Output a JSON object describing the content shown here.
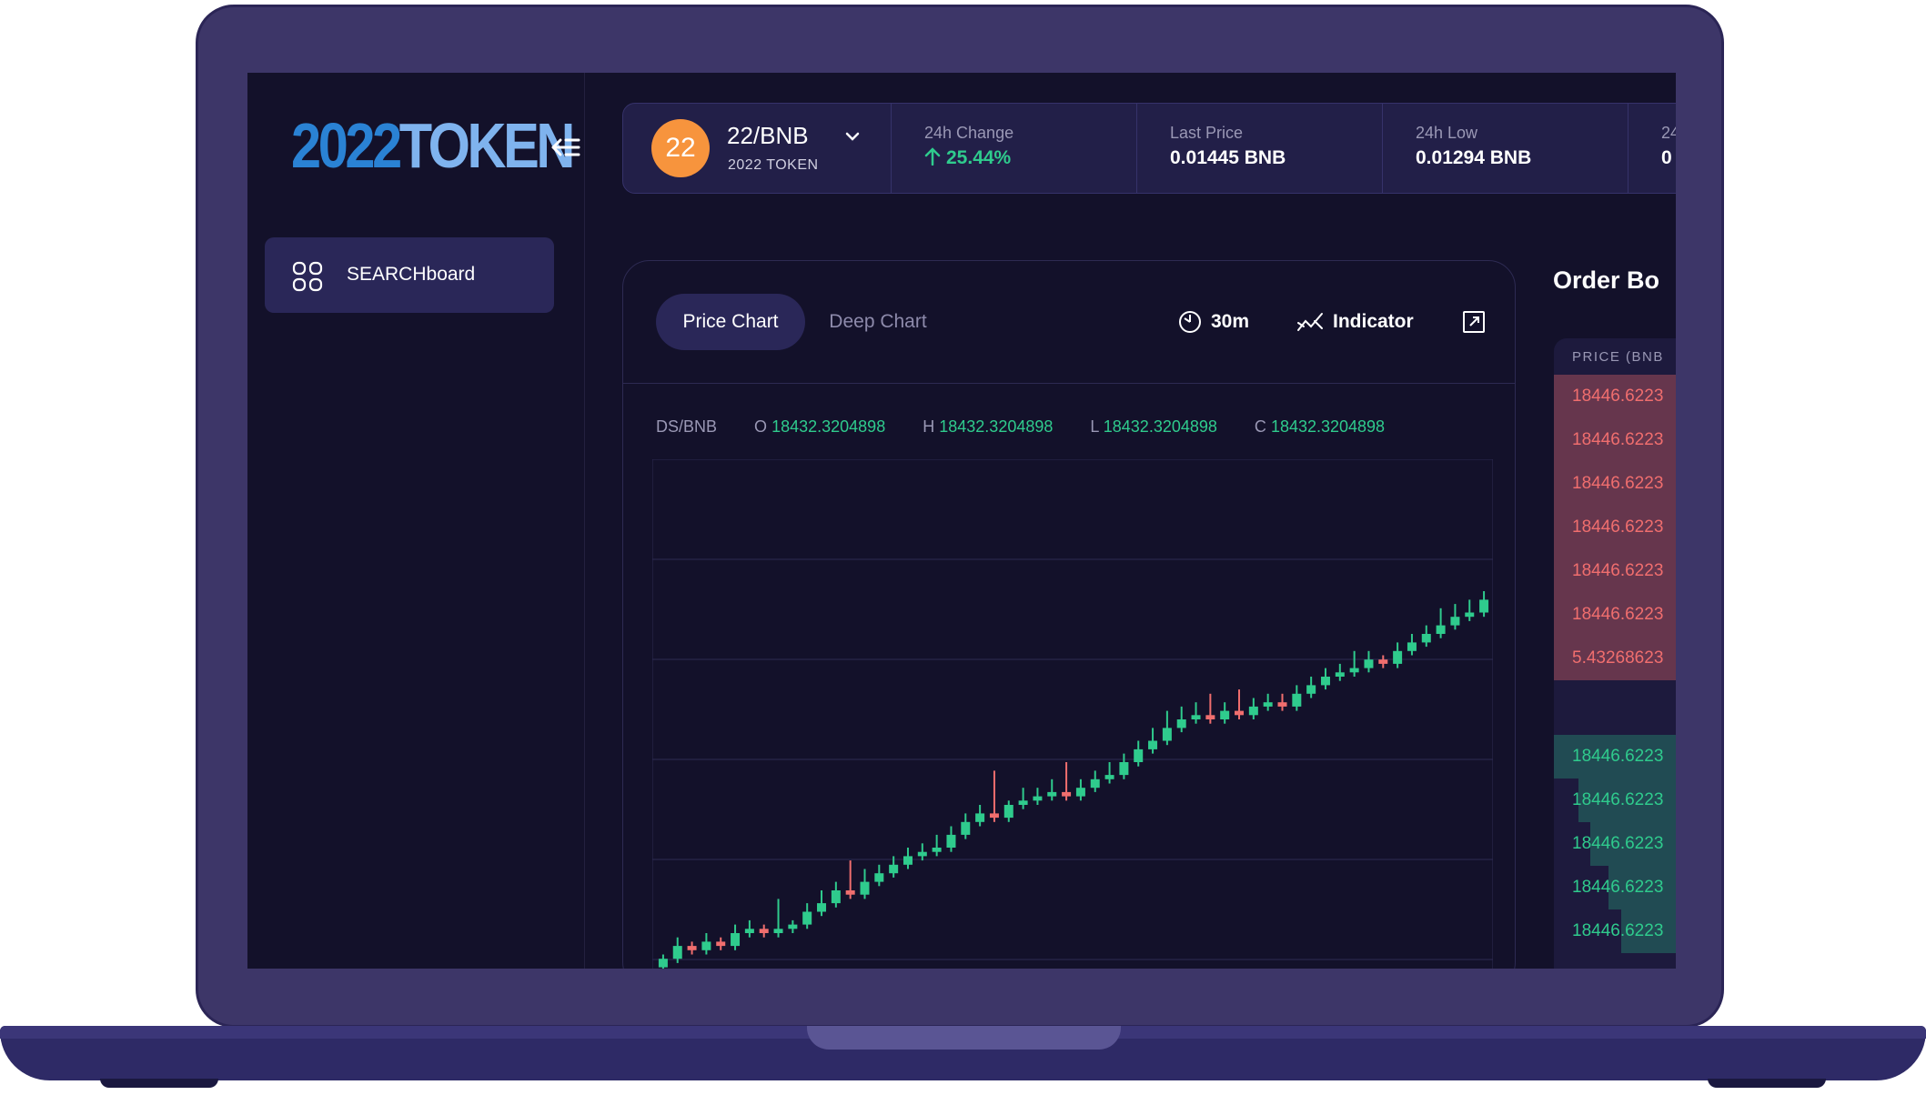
{
  "sidebar": {
    "logo_part1": "2022",
    "logo_part2": "TOKEN",
    "nav_item": "SEARCHboard"
  },
  "header": {
    "coin_badge": "22",
    "pair": "22/BNB",
    "token_name": "2022 TOKEN",
    "stats": [
      {
        "label": "24h Change",
        "value": "25.44%",
        "direction": "up"
      },
      {
        "label": "Last Price",
        "value": "0.01445 BNB"
      },
      {
        "label": "24h Low",
        "value": "0.01294 BNB"
      },
      {
        "label": "24",
        "value": "0"
      }
    ]
  },
  "chart_panel": {
    "tabs": [
      "Price Chart",
      "Deep Chart"
    ],
    "active_tab": "Price Chart",
    "interval": "30m",
    "indicator_label": "Indicator",
    "symbol": "DS/BNB",
    "ohlc": {
      "o_label": "O",
      "o": "18432.3204898",
      "h_label": "H",
      "h": "18432.3204898",
      "l_label": "L",
      "l": "18432.3204898",
      "c_label": "C",
      "c": "18432.3204898"
    }
  },
  "chart_data": {
    "type": "candlestick",
    "up_color": "#2fcb8d",
    "down_color": "#f06e6e",
    "grid": true,
    "candles": [
      [
        0.02,
        0.04,
        0.0,
        0.05
      ],
      [
        0.04,
        0.07,
        0.03,
        0.09
      ],
      [
        0.07,
        0.06,
        0.05,
        0.08
      ],
      [
        0.06,
        0.08,
        0.05,
        0.1
      ],
      [
        0.08,
        0.07,
        0.06,
        0.09
      ],
      [
        0.07,
        0.1,
        0.06,
        0.12
      ],
      [
        0.1,
        0.11,
        0.09,
        0.13
      ],
      [
        0.11,
        0.1,
        0.09,
        0.12
      ],
      [
        0.1,
        0.11,
        0.09,
        0.18
      ],
      [
        0.11,
        0.12,
        0.1,
        0.13
      ],
      [
        0.12,
        0.15,
        0.11,
        0.17
      ],
      [
        0.15,
        0.17,
        0.14,
        0.2
      ],
      [
        0.17,
        0.2,
        0.16,
        0.22
      ],
      [
        0.2,
        0.19,
        0.18,
        0.27
      ],
      [
        0.19,
        0.22,
        0.18,
        0.25
      ],
      [
        0.22,
        0.24,
        0.21,
        0.26
      ],
      [
        0.24,
        0.26,
        0.23,
        0.28
      ],
      [
        0.26,
        0.28,
        0.25,
        0.3
      ],
      [
        0.28,
        0.29,
        0.27,
        0.31
      ],
      [
        0.29,
        0.3,
        0.28,
        0.33
      ],
      [
        0.3,
        0.33,
        0.29,
        0.35
      ],
      [
        0.33,
        0.36,
        0.32,
        0.38
      ],
      [
        0.36,
        0.38,
        0.35,
        0.4
      ],
      [
        0.38,
        0.37,
        0.36,
        0.48
      ],
      [
        0.37,
        0.4,
        0.36,
        0.41
      ],
      [
        0.4,
        0.41,
        0.39,
        0.44
      ],
      [
        0.41,
        0.42,
        0.4,
        0.44
      ],
      [
        0.42,
        0.43,
        0.41,
        0.46
      ],
      [
        0.43,
        0.42,
        0.41,
        0.5
      ],
      [
        0.42,
        0.44,
        0.41,
        0.46
      ],
      [
        0.44,
        0.46,
        0.43,
        0.48
      ],
      [
        0.46,
        0.47,
        0.45,
        0.5
      ],
      [
        0.47,
        0.5,
        0.46,
        0.52
      ],
      [
        0.5,
        0.53,
        0.49,
        0.55
      ],
      [
        0.53,
        0.55,
        0.52,
        0.58
      ],
      [
        0.55,
        0.58,
        0.54,
        0.62
      ],
      [
        0.58,
        0.6,
        0.57,
        0.63
      ],
      [
        0.6,
        0.61,
        0.59,
        0.64
      ],
      [
        0.61,
        0.6,
        0.59,
        0.66
      ],
      [
        0.6,
        0.62,
        0.59,
        0.64
      ],
      [
        0.62,
        0.61,
        0.6,
        0.67
      ],
      [
        0.61,
        0.63,
        0.6,
        0.65
      ],
      [
        0.63,
        0.64,
        0.62,
        0.66
      ],
      [
        0.64,
        0.63,
        0.62,
        0.66
      ],
      [
        0.63,
        0.66,
        0.62,
        0.68
      ],
      [
        0.66,
        0.68,
        0.65,
        0.7
      ],
      [
        0.68,
        0.7,
        0.67,
        0.72
      ],
      [
        0.7,
        0.71,
        0.69,
        0.73
      ],
      [
        0.71,
        0.72,
        0.7,
        0.76
      ],
      [
        0.72,
        0.74,
        0.71,
        0.76
      ],
      [
        0.74,
        0.73,
        0.72,
        0.75
      ],
      [
        0.73,
        0.76,
        0.72,
        0.78
      ],
      [
        0.76,
        0.78,
        0.75,
        0.8
      ],
      [
        0.78,
        0.8,
        0.77,
        0.82
      ],
      [
        0.8,
        0.82,
        0.79,
        0.86
      ],
      [
        0.82,
        0.84,
        0.81,
        0.87
      ],
      [
        0.84,
        0.85,
        0.83,
        0.88
      ],
      [
        0.85,
        0.88,
        0.84,
        0.9
      ]
    ]
  },
  "order_book": {
    "title": "Order Bo",
    "column_header": "PRICE (BNB",
    "asks": [
      "18446.6223",
      "18446.6223",
      "18446.6223",
      "18446.6223",
      "18446.6223",
      "18446.6223",
      "5.43268623"
    ],
    "bids": [
      "18446.6223",
      "18446.6223",
      "18446.6223",
      "18446.6223",
      "18446.6223"
    ],
    "ask_color": "#f06e6e",
    "bid_color": "#2fcb8d"
  }
}
